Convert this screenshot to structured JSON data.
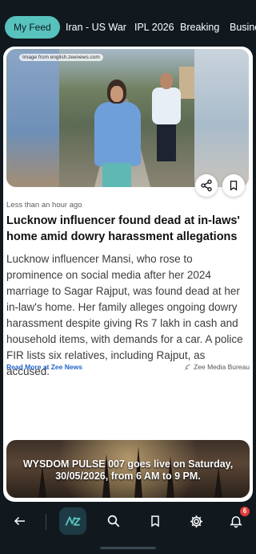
{
  "tabs": [
    {
      "label": "My Feed",
      "active": true
    },
    {
      "label": "Iran - US War",
      "active": false
    },
    {
      "label": "IPL 2026",
      "active": false
    },
    {
      "label": "Breaking",
      "active": false
    },
    {
      "label": "Busine",
      "active": false
    }
  ],
  "article": {
    "image_credit": "Image from english.zeenews.com",
    "time": "Less than an hour ago",
    "headline": "Lucknow influencer found dead at in-laws' home amid dowry harassment allegations",
    "summary": "Lucknow influencer Mansi, who rose to prominence on social media after her 2024 marriage to Sagar Rajput, was found dead at her in-law's home. Her family alleges ongoing dowry harassment despite giving Rs 7 lakh in cash and household items, with demands for a car. A police FIR lists six relatives, including Rajput, as accused.",
    "read_more": "Read More at Zee News",
    "source": "Zee Media Bureau",
    "share_icon": "share-icon",
    "bookmark_icon": "bookmark-icon"
  },
  "ad": {
    "text": "WYSDOM PULSE 007 goes live on Saturday, 30/05/2026, from 6 AM to 9 PM."
  },
  "bottom_nav": {
    "items": [
      "back-icon",
      "app-logo-icon",
      "search-icon",
      "bookmark-icon",
      "settings-icon",
      "notifications-icon"
    ],
    "notification_count": "6"
  },
  "colors": {
    "accent": "#58c2bd",
    "background": "#11191f",
    "link": "#1f63c9",
    "badge": "#e23c3c"
  }
}
